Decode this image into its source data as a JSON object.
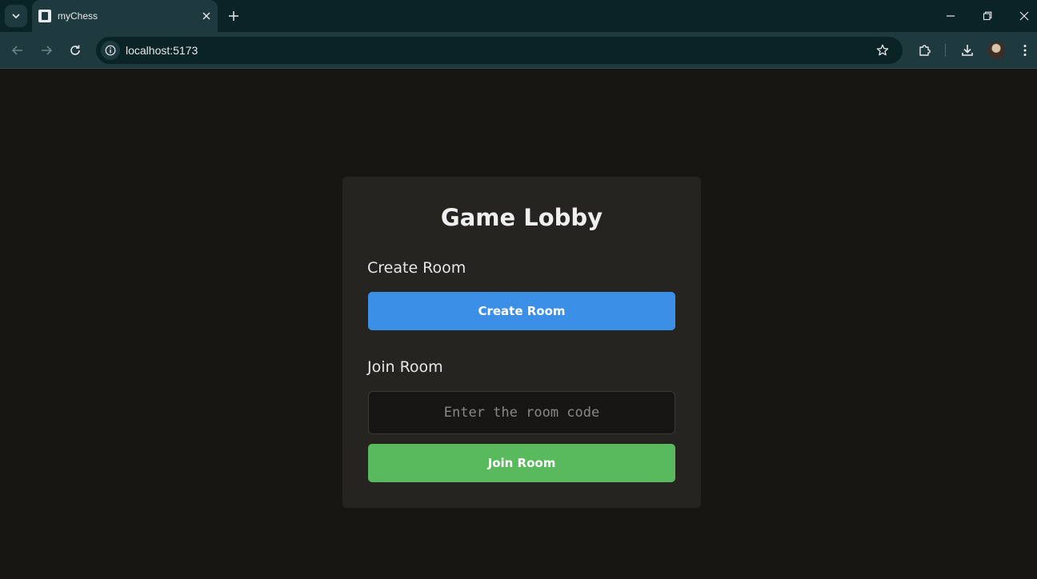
{
  "browser": {
    "tab_title": "myChess",
    "url": "localhost:5173",
    "accent": "#1e3a3e",
    "frame": "#0a2327"
  },
  "lobby": {
    "title": "Game Lobby",
    "create_section_label": "Create Room",
    "create_button_label": "Create Room",
    "join_section_label": "Join Room",
    "room_code_placeholder": "Enter the room code",
    "room_code_value": "",
    "join_button_label": "Join Room",
    "create_color": "#3b8fe6",
    "join_color": "#59b95d"
  }
}
